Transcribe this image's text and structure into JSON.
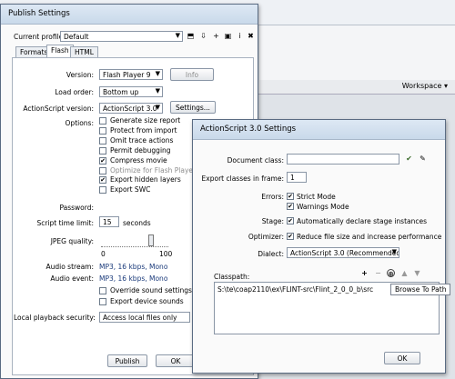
{
  "background": {
    "workspace_label": "Workspace ▾"
  },
  "publish": {
    "title": "Publish Settings",
    "current_profile_label": "Current profile:",
    "current_profile_value": "Default",
    "tabs": [
      "Formats",
      "Flash",
      "HTML"
    ],
    "version_label": "Version:",
    "version_value": "Flash Player 9",
    "info_button": "Info",
    "load_order_label": "Load order:",
    "load_order_value": "Bottom up",
    "as_version_label": "ActionScript version:",
    "as_version_value": "ActionScript 3.0",
    "settings_button": "Settings...",
    "options_label": "Options:",
    "options": [
      {
        "label": "Generate size report",
        "checked": false
      },
      {
        "label": "Protect from import",
        "checked": false
      },
      {
        "label": "Omit trace actions",
        "checked": false
      },
      {
        "label": "Permit debugging",
        "checked": false
      },
      {
        "label": "Compress movie",
        "checked": true
      },
      {
        "label": "Optimize for Flash Player 6 r6",
        "checked": false,
        "disabled": true
      },
      {
        "label": "Export hidden layers",
        "checked": true
      },
      {
        "label": "Export SWC",
        "checked": false
      }
    ],
    "password_label": "Password:",
    "script_time_label": "Script time limit:",
    "script_time_value": "15",
    "seconds_label": "seconds",
    "jpeg_label": "JPEG quality:",
    "jpeg_min": "0",
    "jpeg_max": "100",
    "audio_stream_label": "Audio stream:",
    "audio_stream_value": "MP3, 16 kbps, Mono",
    "audio_event_label": "Audio event:",
    "audio_event_value": "MP3, 16 kbps, Mono",
    "override_label": "Override sound settings",
    "export_device_label": "Export device sounds",
    "local_playback_label": "Local playback security:",
    "local_playback_value": "Access local files only",
    "publish_button": "Publish",
    "ok_button": "OK"
  },
  "as3": {
    "title": "ActionScript 3.0 Settings",
    "doc_class_label": "Document class:",
    "export_frame_label": "Export classes in frame:",
    "export_frame_value": "1",
    "errors_label": "Errors:",
    "strict_mode_label": "Strict Mode",
    "warnings_mode_label": "Warnings Mode",
    "stage_label": "Stage:",
    "stage_option": "Automatically declare stage instances",
    "optimizer_label": "Optimizer:",
    "optimizer_option": "Reduce file size and increase performance",
    "dialect_label": "Dialect:",
    "dialect_value": "ActionScript 3.0 (Recommended)",
    "classpath_label": "Classpath:",
    "classpath_entry": "S:\\te\\coap2110\\ex\\FLINT-src\\Flint_2_0_0_b\\src",
    "tooltip": "Browse To Path",
    "ok_button": "OK"
  }
}
